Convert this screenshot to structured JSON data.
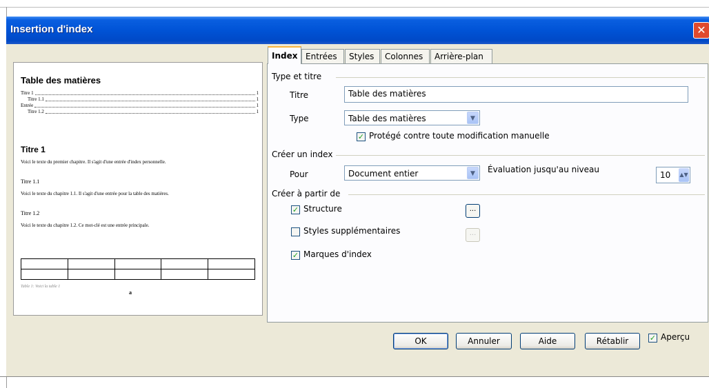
{
  "window": {
    "title": "Insertion d'index",
    "close_glyph": "✕"
  },
  "preview": {
    "toc_title": "Table des matières",
    "toc_entries": [
      {
        "text": "Titre 1",
        "page": "1"
      },
      {
        "text": "Titre 1.1",
        "page": "1"
      },
      {
        "text": "Entrée",
        "page": "1"
      },
      {
        "text": "Titre 1.2",
        "page": "1"
      }
    ],
    "heading1": "Titre 1",
    "body1": "Voici le texte du premier chapitre. Il s'agit d'une entrée d'index personnelle.",
    "heading11": "Titre 1.1",
    "body11": "Voici le texte du chapitre 1.1. Il s'agit d'une entrée pour la table des matières.",
    "heading12": "Titre 1.2",
    "body12": "Voici le texte du chapitre 1.2. Ce mot-clé est une entrée principale.",
    "table_caption": "Table 1: Voici la table 1",
    "mark": "a"
  },
  "tabs": [
    {
      "label": "Index",
      "active": true
    },
    {
      "label": "Entrées",
      "active": false
    },
    {
      "label": "Styles",
      "active": false
    },
    {
      "label": "Colonnes",
      "active": false
    },
    {
      "label": "Arrière-plan",
      "active": false
    }
  ],
  "type_titre": {
    "header": "Type et titre",
    "title_label": "Titre",
    "title_value": "Table des matières",
    "type_label": "Type",
    "type_value": "Table des matières",
    "protect_label": "Protégé contre toute modification manuelle",
    "protect_checked": true
  },
  "creer_index": {
    "header": "Créer un index",
    "pour_label": "Pour",
    "pour_value": "Document entier",
    "eval_label": "Évaluation jusqu'au niveau",
    "eval_value": "10"
  },
  "creer_partir": {
    "header": "Créer à partir de",
    "structure_label": "Structure",
    "structure_checked": true,
    "styles_label": "Styles supplémentaires",
    "styles_checked": false,
    "marques_label": "Marques d'index",
    "marques_checked": true,
    "browse_glyph": "..."
  },
  "buttons": {
    "ok": "OK",
    "cancel": "Annuler",
    "help": "Aide",
    "reset": "Rétablir"
  },
  "apercu": {
    "label": "Aperçu",
    "checked": true
  }
}
